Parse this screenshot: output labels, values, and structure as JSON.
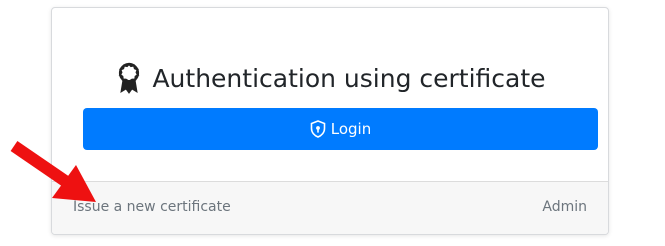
{
  "card": {
    "title": "Authentication using certificate",
    "title_icon": "certificate-award-icon",
    "login_button": {
      "label": "Login",
      "icon": "shield-lock-icon"
    },
    "footer": {
      "issue_link": "Issue a new certificate",
      "admin_link": "Admin"
    }
  },
  "annotation": {
    "icon": "red-arrow-pointer",
    "color": "#ee1111"
  },
  "colors": {
    "primary": "#007bff",
    "footer_bg": "#f7f7f7",
    "muted_text": "#6c757d"
  }
}
